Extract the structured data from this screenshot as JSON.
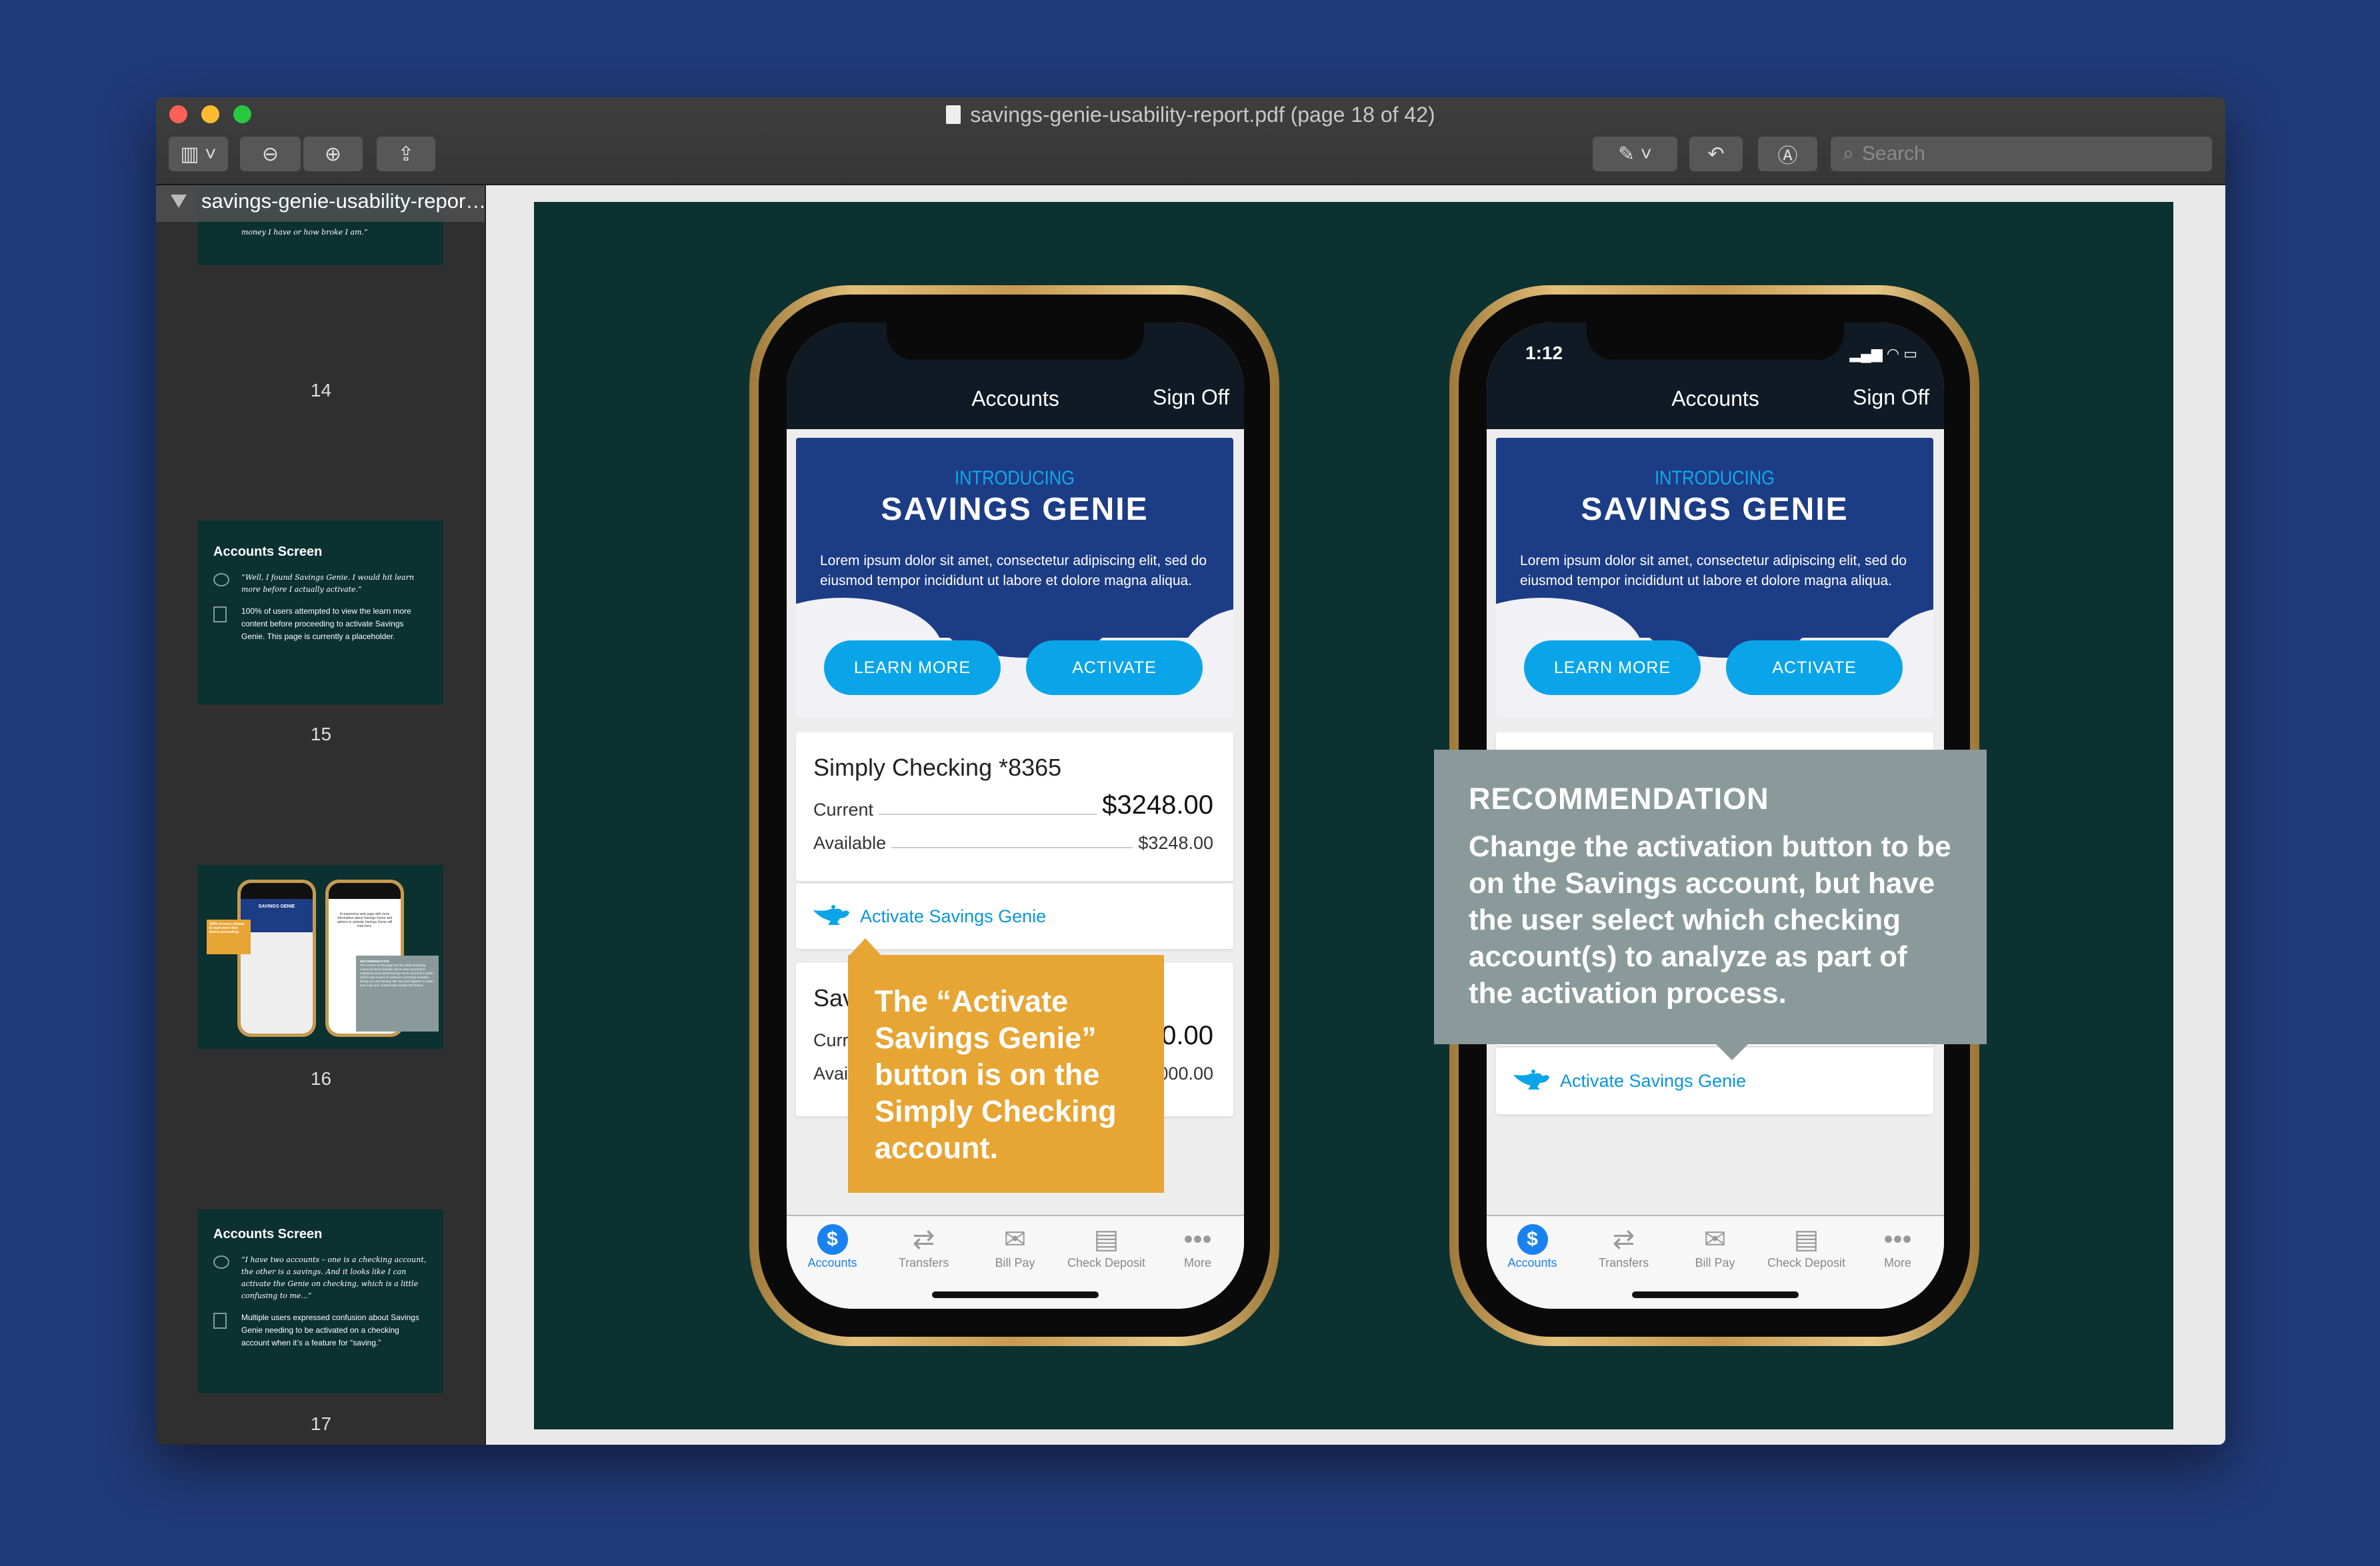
{
  "window": {
    "title": "savings-genie-usability-report.pdf (page 18 of 42)",
    "search_placeholder": "Search",
    "colors": {
      "close": "#fe5f57",
      "minimize": "#febc2e",
      "zoom": "#28c840",
      "desktop": "#213a78",
      "slide": "#0b3131"
    }
  },
  "toolbar": {
    "left_buttons": [
      "sidebar-toggle",
      "zoom-out",
      "zoom-in",
      "share"
    ],
    "right_buttons": [
      "markup",
      "rotate",
      "annotate"
    ]
  },
  "sidebar": {
    "header": "savings-genie-usability-repor…",
    "thumbnails": [
      {
        "page": "14",
        "quote_tail": "money I have or how broke I am.”"
      },
      {
        "page": "15",
        "title": "Accounts Screen",
        "quote": "“Well, I found Savings Genie. I would hit learn more before I actually activate.”",
        "note": "100% of users attempted to view the learn more content before proceeding to activate Savings Genie. This page is currently a placeholder."
      },
      {
        "page": "16",
        "callout": "100% of users clicked to learn more first before proceeding.",
        "web_text": "A responsive web page with more information about Savings Genie and options to activate Savings Genie will load here.",
        "rec_title": "RECOMMENDATION",
        "rec_text": "The content on this page and the initial marketing communications (emails) will be very important in explaining more about Savings Genie and how it works (which was a point of confusion commonly revealed during our user testing). We can work together to make sure copy and content helps explain the feature."
      },
      {
        "page": "17",
        "title": "Accounts Screen",
        "quote": "“I have two accounts – one is a checking account, the other is a savings. And it looks like I can activate the Genie on checking, which is a little confusing to me...”",
        "note": "Multiple users expressed confusion about Savings Genie needing to be activated on a checking account when it’s a feature for “saving.”"
      }
    ]
  },
  "phone": {
    "time": "1:12",
    "nav_title": "Accounts",
    "sign_off": "Sign Off",
    "banner": {
      "introducing": "INTRODUCING",
      "title": "SAVINGS GENIE",
      "body": "Lorem ipsum dolor sit amet, consectetur adipiscing elit, sed do eiusmod tempor incididunt ut labore et dolore magna aliqua.",
      "learn_more": "LEARN MORE",
      "activate": "ACTIVATE"
    },
    "checking": {
      "name": "Simply Checking *8365",
      "current_label": "Current",
      "current": "$3248.00",
      "available_label": "Available",
      "available": "$3248.00"
    },
    "activate_link": "Activate Savings Genie",
    "savings": {
      "name": "Savings *9204",
      "current_label": "Current",
      "current": "$9000.00",
      "available_label": "Available",
      "available": "$9000.00"
    },
    "tabs": [
      {
        "label": "Accounts",
        "icon": "dollar-icon",
        "active": true
      },
      {
        "label": "Transfers",
        "icon": "transfer-arrows-icon"
      },
      {
        "label": "Bill Pay",
        "icon": "bill-pay-icon"
      },
      {
        "label": "Check Deposit",
        "icon": "check-icon"
      },
      {
        "label": "More",
        "icon": "more-dots-icon"
      }
    ],
    "accent": "#0aa5e8"
  },
  "callout": {
    "text": "The “Activate Savings Genie” button is on the Simply Checking account.",
    "color": "#e7a534"
  },
  "recommendation": {
    "title": "RECOMMENDATION",
    "text": "Change the activation button to be on the Savings account, but have the user select which checking account(s) to analyze as part of the activation process.",
    "color": "#8a9a9a"
  }
}
